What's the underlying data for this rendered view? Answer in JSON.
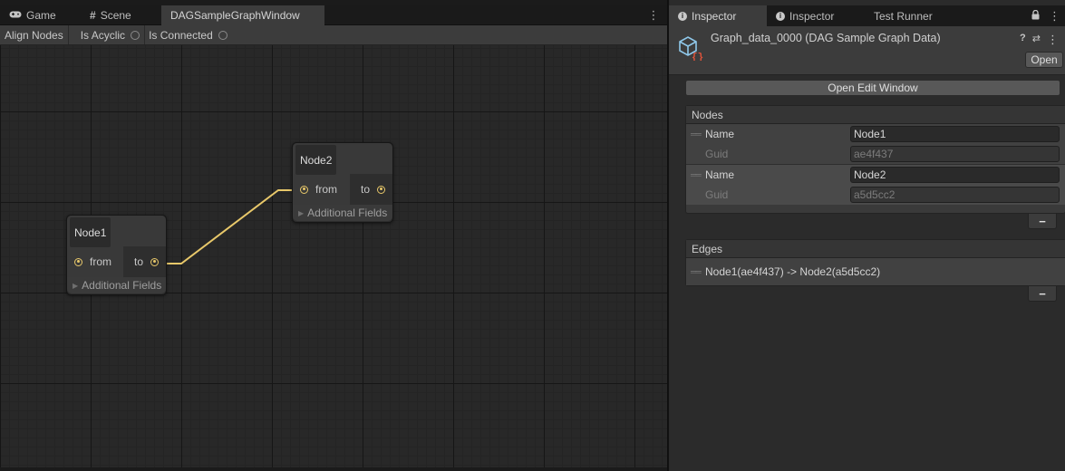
{
  "left_tabs": [
    {
      "label": "Game",
      "icon": "gamepad-icon"
    },
    {
      "label": "Scene",
      "icon": "hash-icon"
    },
    {
      "label": "DAGSampleGraphWindow",
      "icon": ""
    }
  ],
  "toolbar": {
    "align_nodes": "Align Nodes",
    "is_acyclic": "Is Acyclic",
    "is_connected": "Is Connected"
  },
  "graph": {
    "nodes": [
      {
        "title": "Node1",
        "in_port": "from",
        "out_port": "to",
        "extra": "Additional Fields"
      },
      {
        "title": "Node2",
        "in_port": "from",
        "out_port": "to",
        "extra": "Additional Fields"
      }
    ],
    "edge_color": "#e8c86a"
  },
  "right_tabs": [
    {
      "label": "Inspector",
      "icon": "info-icon"
    },
    {
      "label": "Inspector",
      "icon": "info-icon"
    },
    {
      "label": "Test Runner",
      "icon": ""
    }
  ],
  "inspector": {
    "asset_title": "Graph_data_0000 (DAG Sample Graph Data)",
    "open_label": "Open",
    "open_edit_window": "Open Edit Window",
    "nodes_header": "Nodes",
    "nodes": [
      {
        "name_label": "Name",
        "name_value": "Node1",
        "guid_label": "Guid",
        "guid_value": "ae4f437"
      },
      {
        "name_label": "Name",
        "name_value": "Node2",
        "guid_label": "Guid",
        "guid_value": "a5d5cc2"
      }
    ],
    "edges_header": "Edges",
    "edges": [
      "Node1(ae4f437) -> Node2(a5d5cc2)"
    ],
    "remove_label": "−"
  }
}
